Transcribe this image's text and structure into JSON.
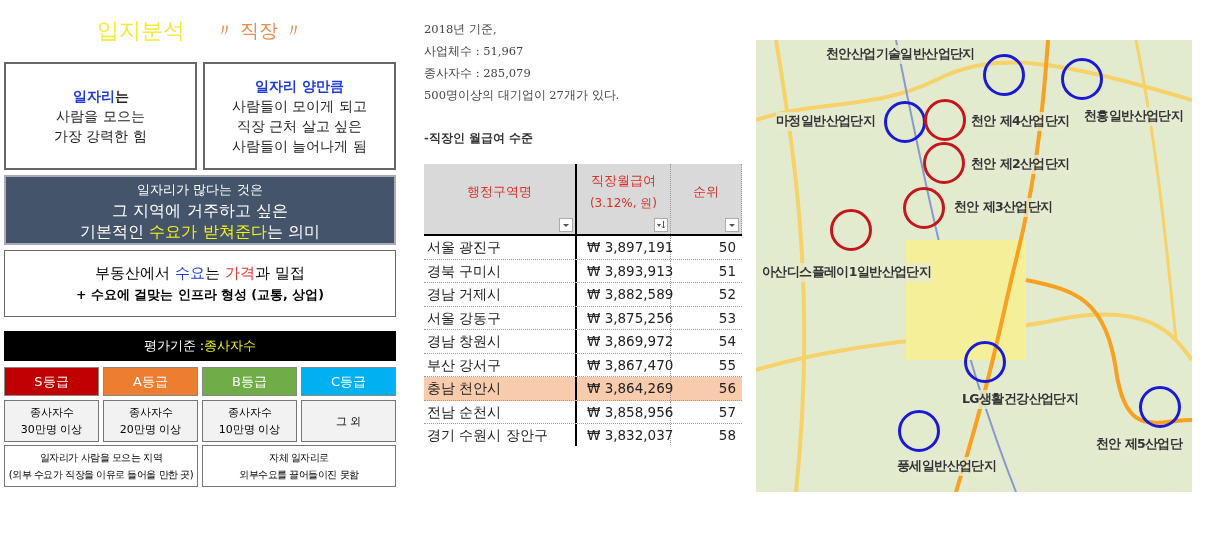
{
  "title": {
    "main": "입지분석",
    "sub": "〃 직장 〃"
  },
  "boxes": [
    {
      "lines": [
        [
          {
            "text": "일자리",
            "kind": "blue"
          },
          {
            "text": "는",
            "kind": "plain"
          }
        ],
        [
          {
            "text": "사람을 모으는",
            "kind": "plain"
          }
        ],
        [
          {
            "text": "가장 강력한 힘",
            "kind": "plain"
          }
        ]
      ]
    },
    {
      "lines": [
        [
          {
            "text": "일자리 양만큼",
            "kind": "blue"
          }
        ],
        [
          {
            "text": "사람들이 모이게 되고",
            "kind": "plain"
          }
        ],
        [
          {
            "text": "직장 근처 살고 싶은",
            "kind": "plain"
          }
        ],
        [
          {
            "text": "사람들이 늘어나게 됨",
            "kind": "plain"
          }
        ]
      ]
    }
  ],
  "meaning": {
    "lines": [
      [
        {
          "text": "일자리가 많다는 것은",
          "kind": "plain"
        }
      ],
      [
        {
          "text": "그 지역에 거주하고 싶은",
          "kind": "plain"
        }
      ],
      [
        {
          "text": "기본적인 ",
          "kind": "plain"
        },
        {
          "text": "수요가 받쳐준다",
          "kind": "yellow"
        },
        {
          "text": "는 의미",
          "kind": "plain"
        }
      ]
    ]
  },
  "demand": {
    "lines": [
      [
        {
          "text": "부동산에서 ",
          "kind": "plain"
        },
        {
          "text": "수요",
          "kind": "blue"
        },
        {
          "text": "는 ",
          "kind": "plain"
        },
        {
          "text": "가격",
          "kind": "red"
        },
        {
          "text": "과 밀접",
          "kind": "plain"
        }
      ],
      [
        {
          "text": "+ 수요에 걸맞는 인프라 형성 (교통, 상업)",
          "kind": "plain"
        }
      ]
    ]
  },
  "criteria": [
    {
      "text": "평가기준 : ",
      "kind": "plain"
    },
    {
      "text": "종사자수",
      "kind": "yellow"
    }
  ],
  "grades": [
    {
      "label": "S등급",
      "color": "#c00000",
      "desc": [
        "종사자수",
        "30만명 이상"
      ]
    },
    {
      "label": "A등급",
      "color": "#ed7d31",
      "desc": [
        "종사자수",
        "20만명 이상"
      ]
    },
    {
      "label": "B등급",
      "color": "#70ad47",
      "desc": [
        "종사자수",
        "10만명 이상"
      ]
    },
    {
      "label": "C등급",
      "color": "#00b0f0",
      "desc": [
        "그 외"
      ]
    }
  ],
  "grade_notes": [
    [
      "일자리가 사람을 모으는 지역",
      "(외부 수요가 직장을 이유로 들어올 만한 곳)"
    ],
    [
      "자체 일자리로",
      "외부수요를 끌어들이진 못함"
    ]
  ],
  "stats": [
    "2018년 기준,",
    "사업체수 : 51,967",
    "종사자수 : 285,079",
    "500명이상의 대기업이 27개가 있다."
  ],
  "salary_heading": "-직장인 월급여 수준",
  "table": {
    "columns": [
      {
        "lines": [
          "행정구역명"
        ],
        "sorted": false
      },
      {
        "lines": [
          "직장월급여",
          "(3.12%, 원)"
        ],
        "sorted": true
      },
      {
        "lines": [
          "순위"
        ],
        "sorted": false
      }
    ],
    "rows": [
      {
        "cells": [
          "서울 광진구",
          "₩ 3,897,191",
          "50"
        ],
        "selected": false
      },
      {
        "cells": [
          "경북 구미시",
          "₩ 3,893,913",
          "51"
        ],
        "selected": false
      },
      {
        "cells": [
          "경남 거제시",
          "₩ 3,882,589",
          "52"
        ],
        "selected": false
      },
      {
        "cells": [
          "서울 강동구",
          "₩ 3,875,256",
          "53"
        ],
        "selected": false
      },
      {
        "cells": [
          "경남 창원시",
          "₩ 3,869,972",
          "54"
        ],
        "selected": false
      },
      {
        "cells": [
          "부산 강서구",
          "₩ 3,867,470",
          "55"
        ],
        "selected": false
      },
      {
        "cells": [
          "충남 천안시",
          "₩ 3,864,269",
          "56"
        ],
        "selected": true
      },
      {
        "cells": [
          "전남 순천시",
          "₩ 3,858,956",
          "57"
        ],
        "selected": false
      },
      {
        "cells": [
          "경기 수원시 장안구",
          "₩ 3,832,037",
          "58"
        ],
        "selected": false
      }
    ]
  },
  "map": {
    "sites": [
      {
        "label": "천안산업기술일반산업단지",
        "kind": "blue"
      },
      {
        "label": "마정일반산업단지",
        "kind": "blue"
      },
      {
        "label": "천안 제4산업단지",
        "kind": "red"
      },
      {
        "label": "천흥일반산업단지",
        "kind": "blue"
      },
      {
        "label": "천안 제2산업단지",
        "kind": "red"
      },
      {
        "label": "천안 제3산업단지",
        "kind": "red"
      },
      {
        "label": "아산디스플레이1일반산업단지",
        "kind": "red"
      },
      {
        "label": "LG생활건강산업단지",
        "kind": "blue"
      },
      {
        "label": "천안 제5산업단",
        "kind": "blue"
      },
      {
        "label": "풍세일반산업단지",
        "kind": "blue"
      }
    ]
  }
}
